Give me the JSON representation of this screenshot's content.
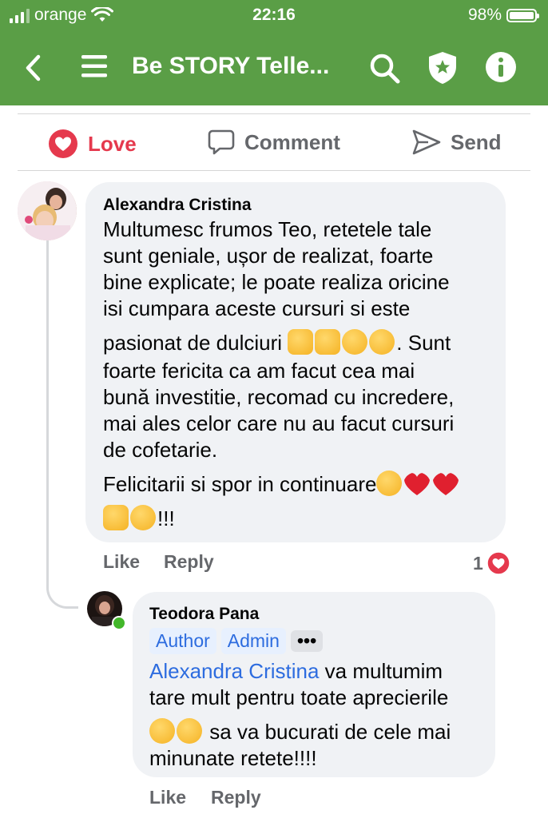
{
  "status_bar": {
    "carrier": "orange",
    "time": "22:16",
    "battery": "98%"
  },
  "header": {
    "title": "Be STORY Telle..."
  },
  "actions": {
    "love": "Love",
    "comment": "Comment",
    "send": "Send"
  },
  "comments": [
    {
      "author": "Alexandra Cristina",
      "lines": [
        "Multumesc frumos Teo, retetele tale",
        "sunt geniale, ușor de realizat, foarte",
        "bine explicate; le poate realiza oricine",
        "isi cumpara aceste cursuri si este"
      ],
      "line5": "pasionat de dulciuri",
      "line5_end": ". Sunt",
      "lines_b": [
        "foarte fericita ca am facut cea mai",
        "bună investitie, recomad cu incredere,",
        "mai ales celor care nu au facut cursuri",
        "de cofetarie."
      ],
      "line_felicitari": "Felicitarii si spor in continuare",
      "line_last_end": "!!!",
      "like": "Like",
      "reply": "Reply",
      "reaction_count": "1"
    },
    {
      "author": "Teodora Pana",
      "badges": [
        "Author",
        "Admin"
      ],
      "more": "•••",
      "mention": "Alexandra Cristina",
      "text1": " va multumim",
      "text2": "tare mult pentru toate aprecierile",
      "text3": " sa va bucurati de cele mai",
      "text4": "minunate retete!!!!",
      "like": "Like",
      "reply": "Reply"
    }
  ],
  "colors": {
    "header_green": "#5a9e46",
    "love_red": "#e5394d",
    "link_blue": "#2d6cdf"
  }
}
